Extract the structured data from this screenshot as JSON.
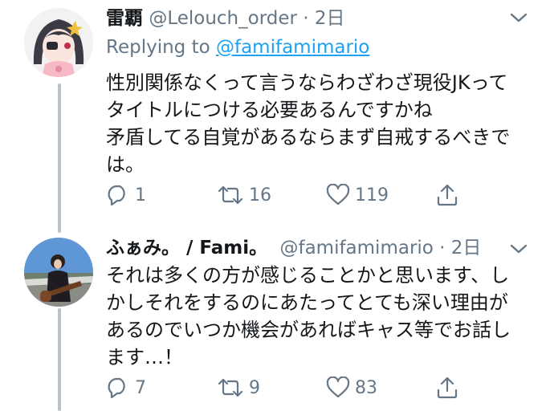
{
  "tweets": [
    {
      "name": "雷覇",
      "handle": "@Lelouch_order",
      "dot": "·",
      "time": "2日",
      "replying_label": "Replying to",
      "replying_to": "@famifamimario",
      "lines": [
        "性別関係なくって言うならわざわざ現役JKって",
        "タイトルにつける必要あるんですかね",
        "矛盾してる自覚があるならまず自戒するべきで",
        "は。"
      ],
      "replies": "1",
      "retweets": "16",
      "likes": "119"
    },
    {
      "name": "ふぁみ。 / Fami。",
      "handle": "@famifamimario",
      "dot": "·",
      "time": "2日",
      "lines": [
        "それは多くの方が感じることかと思います、し",
        "かしそれをするのにあたってとても深い理由が",
        "あるのでいつか機会があればキャス等でお話し",
        "ます…！"
      ],
      "replies": "7",
      "retweets": "9",
      "likes": "83"
    }
  ],
  "icons": [
    "reply-icon",
    "retweet-icon",
    "like-icon",
    "share-icon",
    "chevron-down-icon"
  ],
  "colors": {
    "muted": "#657786",
    "link": "#1da1f2",
    "thread_line": "#b9c3cc",
    "text": "#14171a"
  }
}
